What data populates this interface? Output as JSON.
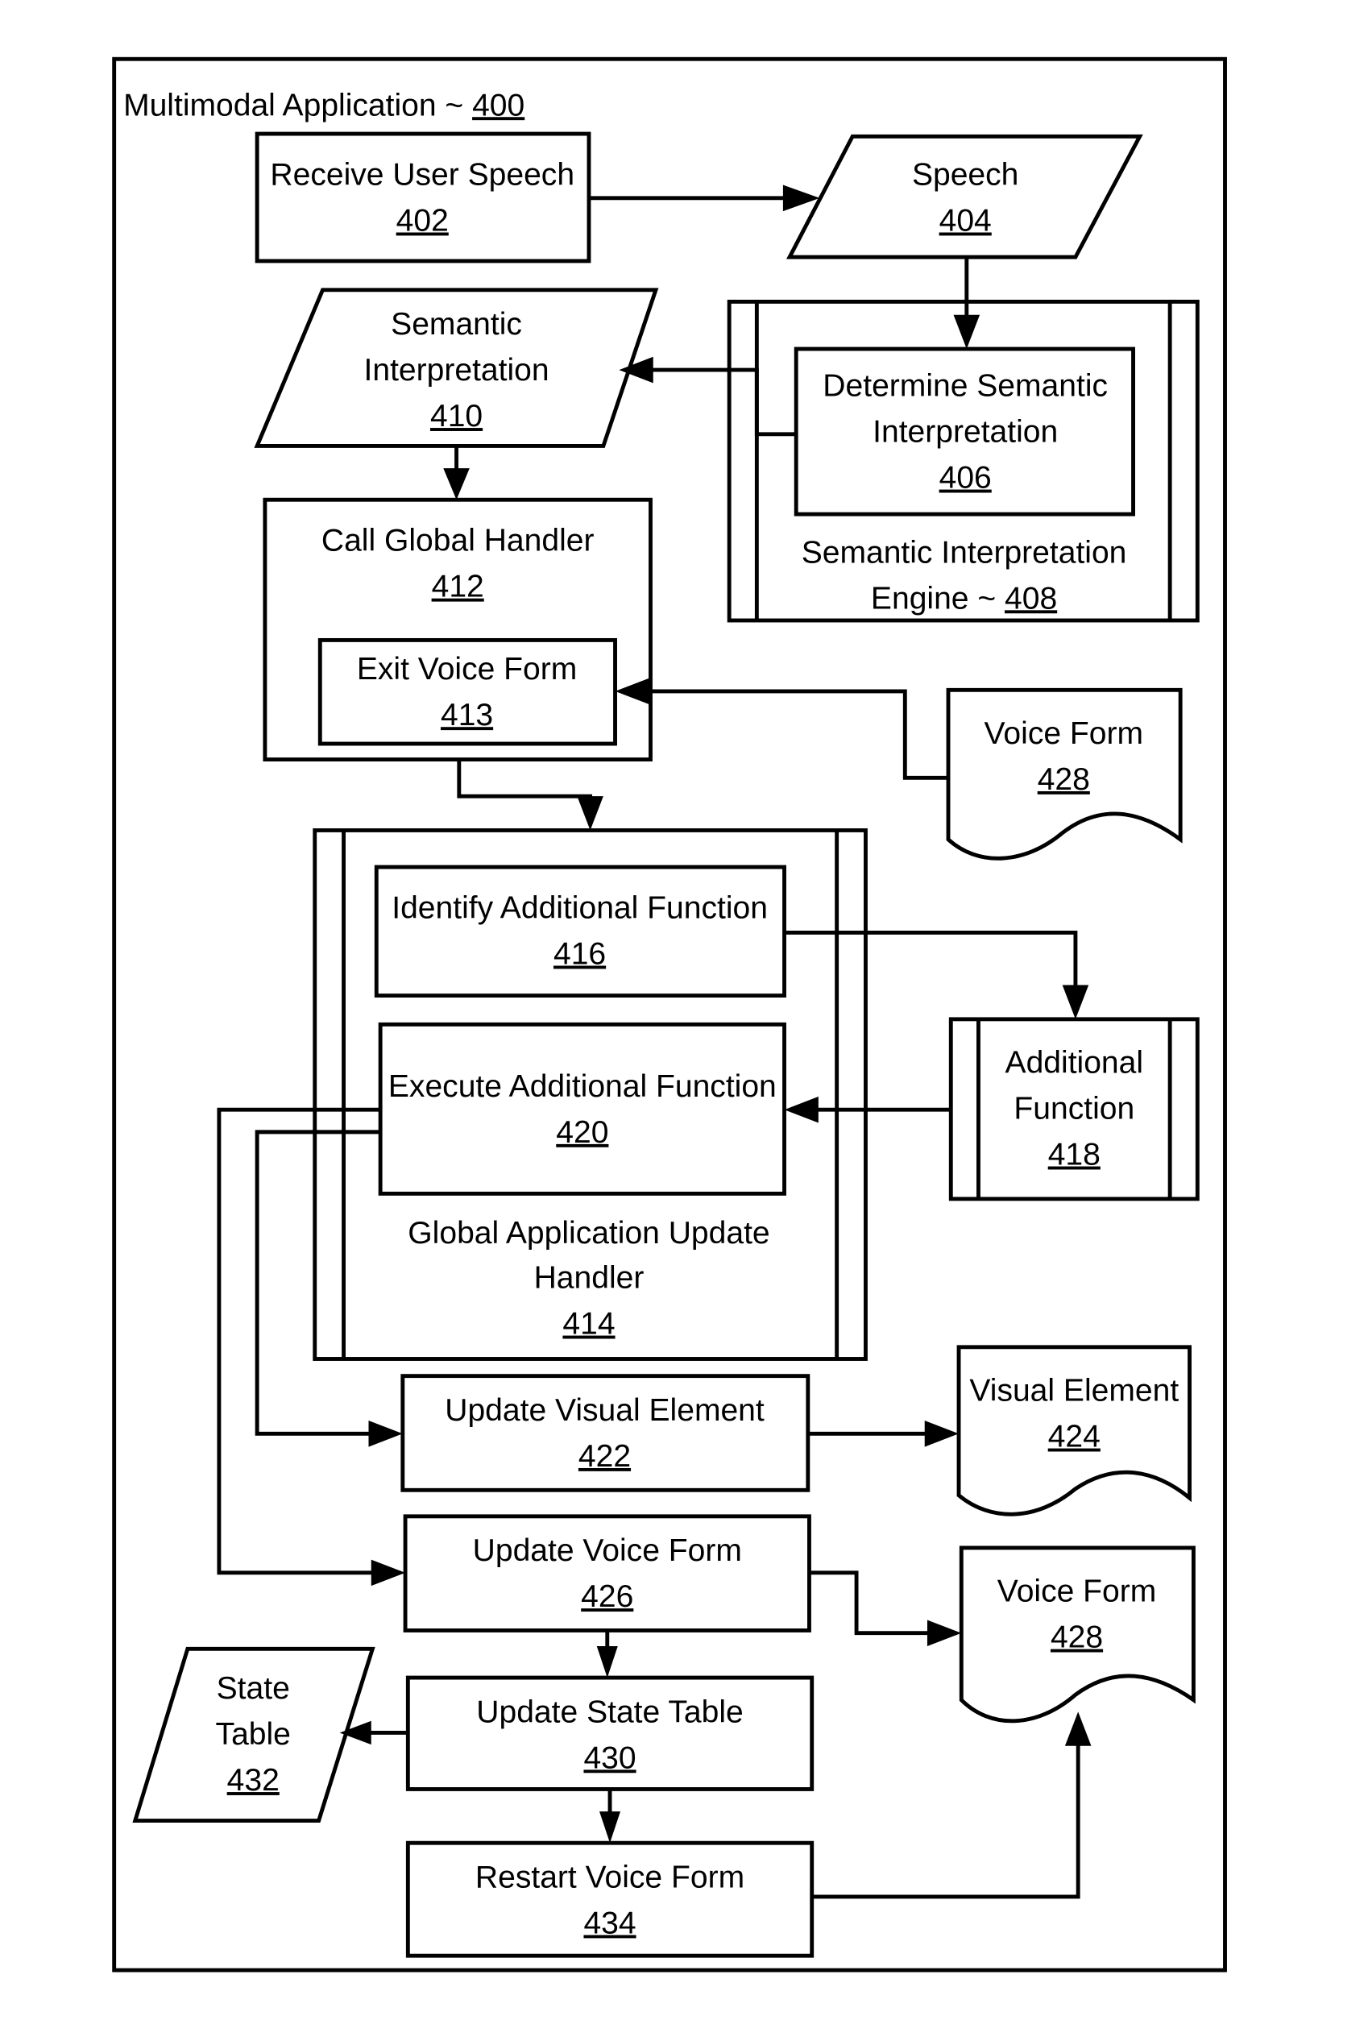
{
  "container": {
    "title": "Multimodal Application ~ ",
    "number": "400"
  },
  "nodes": {
    "n402": {
      "lines": [
        "Receive User Speech"
      ],
      "number": "402",
      "shape": "process"
    },
    "n404": {
      "lines": [
        "Speech"
      ],
      "number": "404",
      "shape": "data"
    },
    "n406": {
      "lines": [
        "Determine Semantic",
        "Interpretation"
      ],
      "number": "406",
      "shape": "process"
    },
    "n408": {
      "lines": [
        "Semantic Interpretation",
        "Engine ~ "
      ],
      "number": "408",
      "shape": "predefined-process"
    },
    "n410": {
      "lines": [
        "Semantic",
        "Interpretation"
      ],
      "number": "410",
      "shape": "data"
    },
    "n412": {
      "lines": [
        "Call Global Handler"
      ],
      "number": "412",
      "shape": "process"
    },
    "n413": {
      "lines": [
        "Exit Voice Form"
      ],
      "number": "413",
      "shape": "process"
    },
    "n428a": {
      "lines": [
        "Voice Form"
      ],
      "number": "428",
      "shape": "document"
    },
    "n414": {
      "lines": [
        "Global Application Update",
        "Handler"
      ],
      "number": "414",
      "shape": "predefined-process"
    },
    "n416": {
      "lines": [
        "Identify Additional Function"
      ],
      "number": "416",
      "shape": "process"
    },
    "n418": {
      "lines": [
        "Additional",
        "Function"
      ],
      "number": "418",
      "shape": "predefined-process"
    },
    "n420": {
      "lines": [
        "Execute Additional Function"
      ],
      "number": "420",
      "shape": "process"
    },
    "n422": {
      "lines": [
        "Update Visual Element"
      ],
      "number": "422",
      "shape": "process"
    },
    "n424": {
      "lines": [
        "Visual Element"
      ],
      "number": "424",
      "shape": "document"
    },
    "n426": {
      "lines": [
        "Update Voice Form"
      ],
      "number": "426",
      "shape": "process"
    },
    "n428b": {
      "lines": [
        "Voice Form"
      ],
      "number": "428",
      "shape": "document"
    },
    "n430": {
      "lines": [
        "Update State Table"
      ],
      "number": "430",
      "shape": "process"
    },
    "n432": {
      "lines": [
        "State",
        "Table"
      ],
      "number": "432",
      "shape": "data"
    },
    "n434": {
      "lines": [
        "Restart Voice Form"
      ],
      "number": "434",
      "shape": "process"
    }
  },
  "edges": [
    {
      "from": "402",
      "to": "404"
    },
    {
      "from": "404",
      "to": "406"
    },
    {
      "from": "408",
      "to": "410"
    },
    {
      "from": "410",
      "to": "412"
    },
    {
      "from": "428",
      "to": "413"
    },
    {
      "from": "412",
      "to": "414"
    },
    {
      "from": "416",
      "to": "418"
    },
    {
      "from": "418",
      "to": "420"
    },
    {
      "from": "420",
      "to": "422"
    },
    {
      "from": "420",
      "to": "426"
    },
    {
      "from": "422",
      "to": "424"
    },
    {
      "from": "426",
      "to": "428"
    },
    {
      "from": "426",
      "to": "430"
    },
    {
      "from": "430",
      "to": "432"
    },
    {
      "from": "430",
      "to": "434"
    },
    {
      "from": "434",
      "to": "428"
    }
  ]
}
